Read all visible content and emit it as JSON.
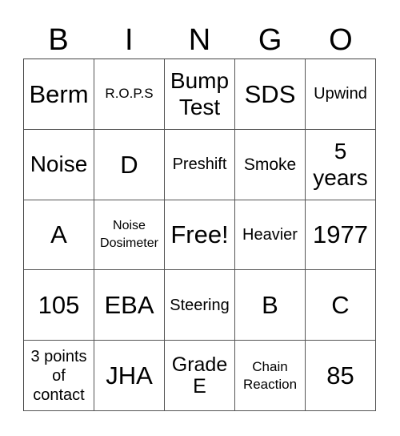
{
  "header": {
    "letters": [
      "B",
      "I",
      "N",
      "G",
      "O"
    ]
  },
  "card": {
    "rows": [
      [
        "Berm",
        "R.O.P.S",
        "Bump\nTest",
        "SDS",
        "Upwind"
      ],
      [
        "Noise",
        "D",
        "Preshift",
        "Smoke",
        "5\nyears"
      ],
      [
        "A",
        "Noise\nDosimeter",
        "Free!",
        "Heavier",
        "1977"
      ],
      [
        "105",
        "EBA",
        "Steering",
        "B",
        "C"
      ],
      [
        "3 points\nof\ncontact",
        "JHA",
        "Grade\nE",
        "Chain\nReaction",
        "85"
      ]
    ]
  }
}
